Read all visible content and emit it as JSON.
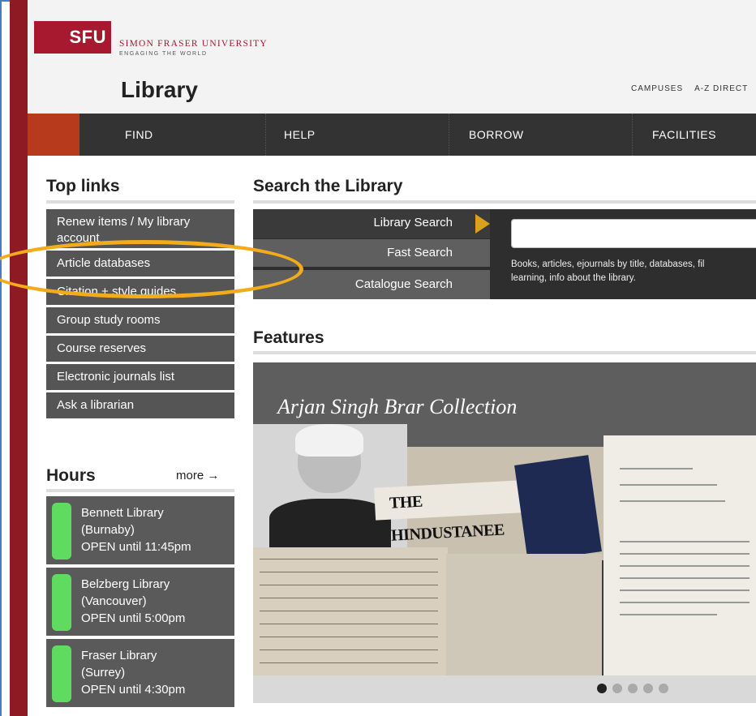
{
  "header": {
    "logo_text": "SFU",
    "university_name": "SIMON FRASER UNIVERSITY",
    "tagline": "ENGAGING THE WORLD",
    "site_title": "Library",
    "utility_nav": [
      "CAMPUSES",
      "A-Z DIRECT"
    ]
  },
  "main_nav": {
    "items": [
      "FIND",
      "HELP",
      "BORROW",
      "FACILITIES"
    ]
  },
  "top_links": {
    "title": "Top links",
    "items": [
      "Renew items / My library account",
      "Article databases",
      "Citation + style guides",
      "Group study rooms",
      "Course reserves",
      "Electronic journals list",
      "Ask a librarian"
    ]
  },
  "hours": {
    "title": "Hours",
    "more_label": "more →",
    "libraries": [
      {
        "name": "Bennett Library",
        "location": "(Burnaby)",
        "status": "OPEN until 11:45pm"
      },
      {
        "name": "Belzberg Library",
        "location": "(Vancouver)",
        "status": "OPEN until 5:00pm"
      },
      {
        "name": "Fraser Library",
        "location": "(Surrey)",
        "status": "OPEN until 4:30pm"
      }
    ]
  },
  "search": {
    "title": "Search the Library",
    "tabs": [
      "Library Search",
      "Fast Search",
      "Catalogue Search"
    ],
    "active_tab": "Library Search",
    "input_value": "",
    "hint_line1": "Books, articles, ejournals by title, databases, fil",
    "hint_line2": "learning, info about the library."
  },
  "features": {
    "title": "Features",
    "slide_title": "Arjan Singh Brar Collection",
    "newspaper_title": "THE HINDUSTANEE",
    "dots_total": 5,
    "active_dot": 1
  },
  "colors": {
    "sfu_red": "#a6192e",
    "nav_dark": "#333333",
    "nav_accent": "#b83a1c",
    "link_bg": "#555555",
    "status_open": "#5fdc5f",
    "highlight": "#f2ab1a"
  }
}
